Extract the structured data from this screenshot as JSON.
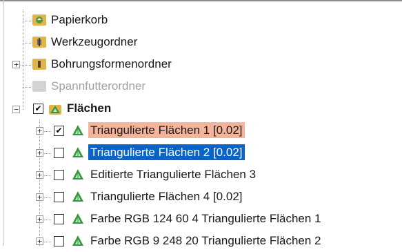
{
  "tree": {
    "items": [
      {
        "label": "Papierkorb",
        "icon": "recycle-folder-icon",
        "state": "normal"
      },
      {
        "label": "Werkzeugordner",
        "icon": "tool-folder-icon",
        "state": "normal"
      },
      {
        "label": "Bohrungsformenordner",
        "icon": "hole-feature-folder-icon",
        "state": "normal"
      },
      {
        "label": "Spannfutterordner",
        "icon": "fixture-folder-icon",
        "state": "disabled"
      },
      {
        "label": "Flächen",
        "icon": "surfaces-folder-icon",
        "state": "bold",
        "checked": true
      },
      {
        "label": "Triangulierte Flächen 1 [0.02]",
        "icon": "triangle-mesh-icon",
        "state": "highlight",
        "checked": true
      },
      {
        "label": "Triangulierte Flächen 2 [0.02]",
        "icon": "triangle-mesh-icon",
        "state": "selected",
        "checked": false
      },
      {
        "label": "Editierte Triangulierte Flächen 3",
        "icon": "triangle-mesh-icon",
        "state": "normal",
        "checked": false
      },
      {
        "label": "Triangulierte Flächen 4 [0.02]",
        "icon": "triangle-mesh-icon",
        "state": "normal",
        "checked": false
      },
      {
        "label": "Farbe RGB 124 60 4 Triangulierte Flächen 1",
        "icon": "triangle-mesh-icon",
        "state": "normal",
        "checked": false
      },
      {
        "label": "Farbe RGB 9 248 20 Triangulierte Flächen 2",
        "icon": "triangle-mesh-icon",
        "state": "normal",
        "checked": false
      }
    ]
  },
  "colors": {
    "highlight_bg": "#f3b49b",
    "selected_bg": "#0a64c8",
    "selected_text": "#ffffff",
    "folder_green": "#78b040",
    "folder_gold": "#e3b24a",
    "folder_gray": "#d4d4d4",
    "mesh_green": "#2e9a3e"
  }
}
